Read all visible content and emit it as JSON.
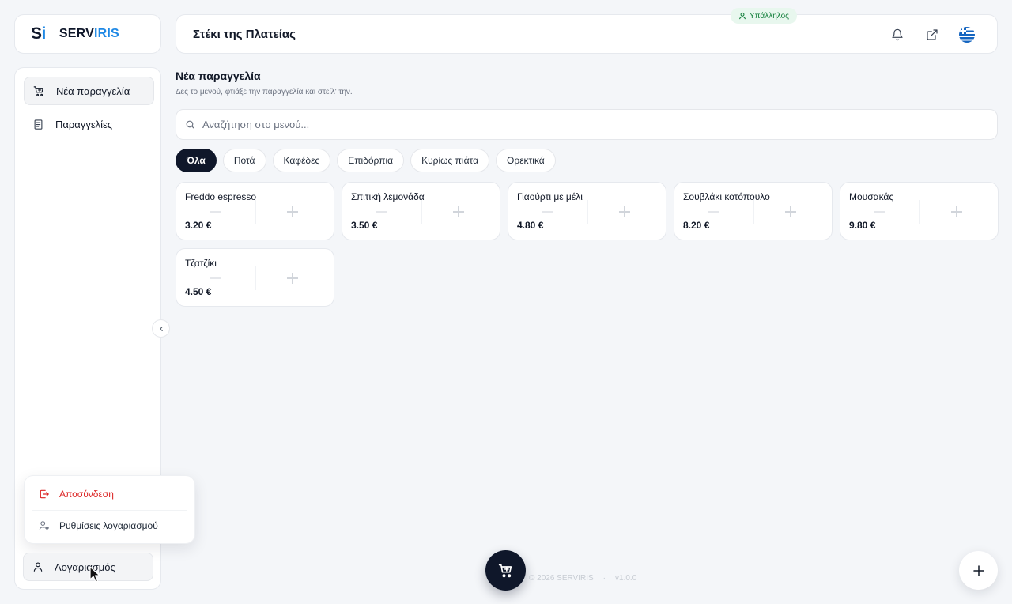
{
  "brand": {
    "mark": "S",
    "mark_i": "i",
    "name_a": "SERV",
    "name_b": "IRIS"
  },
  "header": {
    "title": "Στέκι της Πλατείας",
    "role_badge": "Υπάλληλος",
    "icons": [
      "bell-icon",
      "external-link-icon",
      "greek-flag-icon"
    ]
  },
  "sidebar": {
    "items": [
      {
        "label": "Νέα παραγγελία",
        "icon": "cart-plus-icon",
        "active": true
      },
      {
        "label": "Παραγγελίες",
        "icon": "receipt-icon",
        "active": false
      }
    ],
    "account_label": "Λογαριασμός",
    "account_menu": {
      "logout": "Αποσύνδεση",
      "settings": "Ρυθμίσεις λογαριασμού"
    }
  },
  "main": {
    "title": "Νέα παραγγελία",
    "subtitle": "Δες το μενού, φτιάξε την παραγγελία και στείλ' την.",
    "search_placeholder": "Αναζήτηση στο μενού...",
    "categories": [
      "Όλα",
      "Ποτά",
      "Καφέδες",
      "Επιδόρπια",
      "Κυρίως πιάτα",
      "Ορεκτικά"
    ],
    "active_category": "Όλα",
    "products": [
      {
        "name": "Freddo espresso",
        "price": "3.20 €"
      },
      {
        "name": "Σπιτική λεμονάδα",
        "price": "3.50 €"
      },
      {
        "name": "Γιαούρτι με μέλι",
        "price": "4.80 €"
      },
      {
        "name": "Σουβλάκι κοτόπουλο",
        "price": "8.20 €"
      },
      {
        "name": "Μουσακάς",
        "price": "9.80 €"
      },
      {
        "name": "Τζατζίκι",
        "price": "4.50 €"
      }
    ]
  },
  "footer": {
    "copyright": "© 2026 SERVIRIS",
    "dot": "·",
    "version": "v1.0.0"
  },
  "colors": {
    "accent": "#1e88e5",
    "dark": "#0f172a",
    "danger": "#dc2626",
    "badge_bg": "#e8f7ee",
    "badge_text": "#15803d"
  }
}
